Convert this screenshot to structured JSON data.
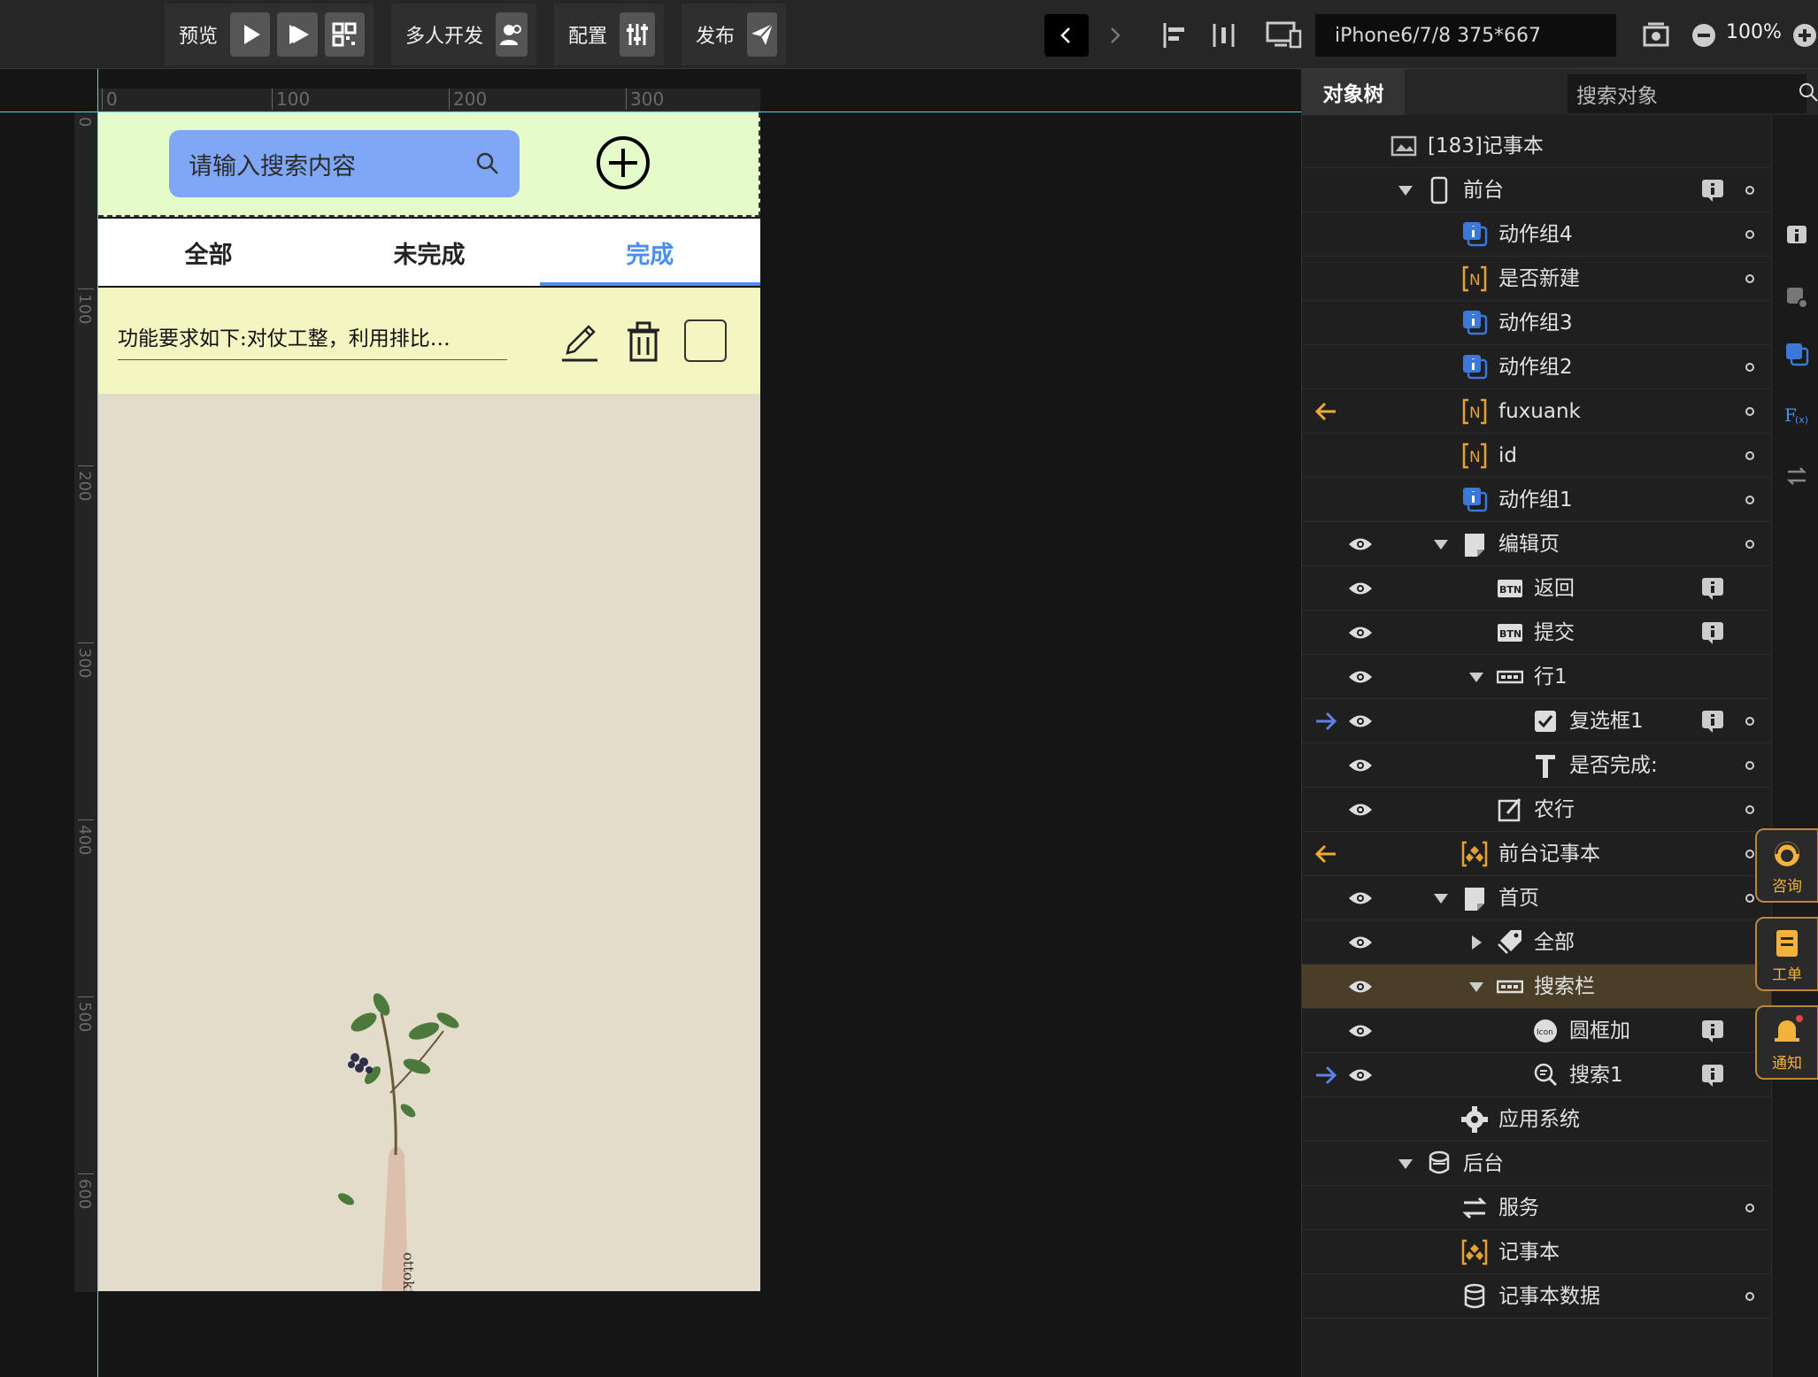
{
  "toolbar": {
    "preview_label": "预览",
    "collab_label": "多人开发",
    "config_label": "配置",
    "publish_label": "发布",
    "device": "iPhone6/7/8 375*667",
    "zoom": "100%"
  },
  "canvas": {
    "ruler_top": [
      "0",
      "100",
      "200",
      "300"
    ],
    "ruler_left": [
      "0",
      "100",
      "200",
      "300",
      "400",
      "500",
      "600"
    ]
  },
  "phone": {
    "search_placeholder": "请输入搜索内容",
    "tabs": [
      "全部",
      "未完成",
      "完成"
    ],
    "active_tab": "完成",
    "row_text": "功能要求如下:对仗工整，利用排比…",
    "colors": {
      "search_bg": "#e6fbca",
      "input_bg": "#7fa7f5",
      "accent": "#4a8ef0",
      "row_bg": "#f4f6c2",
      "page_bg": "#e3dccb"
    }
  },
  "side": {
    "tab_tree": "对象树",
    "search_placeholder": "搜索对象",
    "tree": [
      {
        "label": "[183]记事本",
        "icon": "app-icon"
      },
      {
        "label": "前台",
        "icon": "phone-icon"
      },
      {
        "label": "动作组4",
        "icon": "action-group-icon"
      },
      {
        "label": "是否新建",
        "icon": "variable-icon"
      },
      {
        "label": "动作组3",
        "icon": "action-group-icon"
      },
      {
        "label": "动作组2",
        "icon": "action-group-icon"
      },
      {
        "label": "fuxuank",
        "icon": "variable-icon"
      },
      {
        "label": "id",
        "icon": "variable-icon"
      },
      {
        "label": "动作组1",
        "icon": "action-group-icon"
      },
      {
        "label": "编辑页",
        "icon": "page-icon"
      },
      {
        "label": "返回",
        "icon": "button-icon"
      },
      {
        "label": "提交",
        "icon": "button-icon"
      },
      {
        "label": "行1",
        "icon": "row-icon"
      },
      {
        "label": "复选框1",
        "icon": "checkbox-icon"
      },
      {
        "label": "是否完成:",
        "icon": "text-icon"
      },
      {
        "label": "农行",
        "icon": "edit-icon"
      },
      {
        "label": "前台记事本",
        "icon": "data-model-icon"
      },
      {
        "label": "首页",
        "icon": "page-icon"
      },
      {
        "label": "全部",
        "icon": "tag-icon"
      },
      {
        "label": "搜索栏",
        "icon": "row-icon"
      },
      {
        "label": "圆框加",
        "icon": "icon-component-icon"
      },
      {
        "label": "搜索1",
        "icon": "search-component-icon"
      },
      {
        "label": "应用系统",
        "icon": "gear-icon"
      },
      {
        "label": "后台",
        "icon": "server-icon"
      },
      {
        "label": "服务",
        "icon": "service-icon"
      },
      {
        "label": "记事本",
        "icon": "data-model-icon"
      },
      {
        "label": "记事本数据",
        "icon": "database-icon"
      }
    ],
    "btn_icon": "Btn",
    "icon_badge": "Icon",
    "help_consult": "咨询",
    "help_ticket": "工单",
    "help_notify": "通知"
  }
}
